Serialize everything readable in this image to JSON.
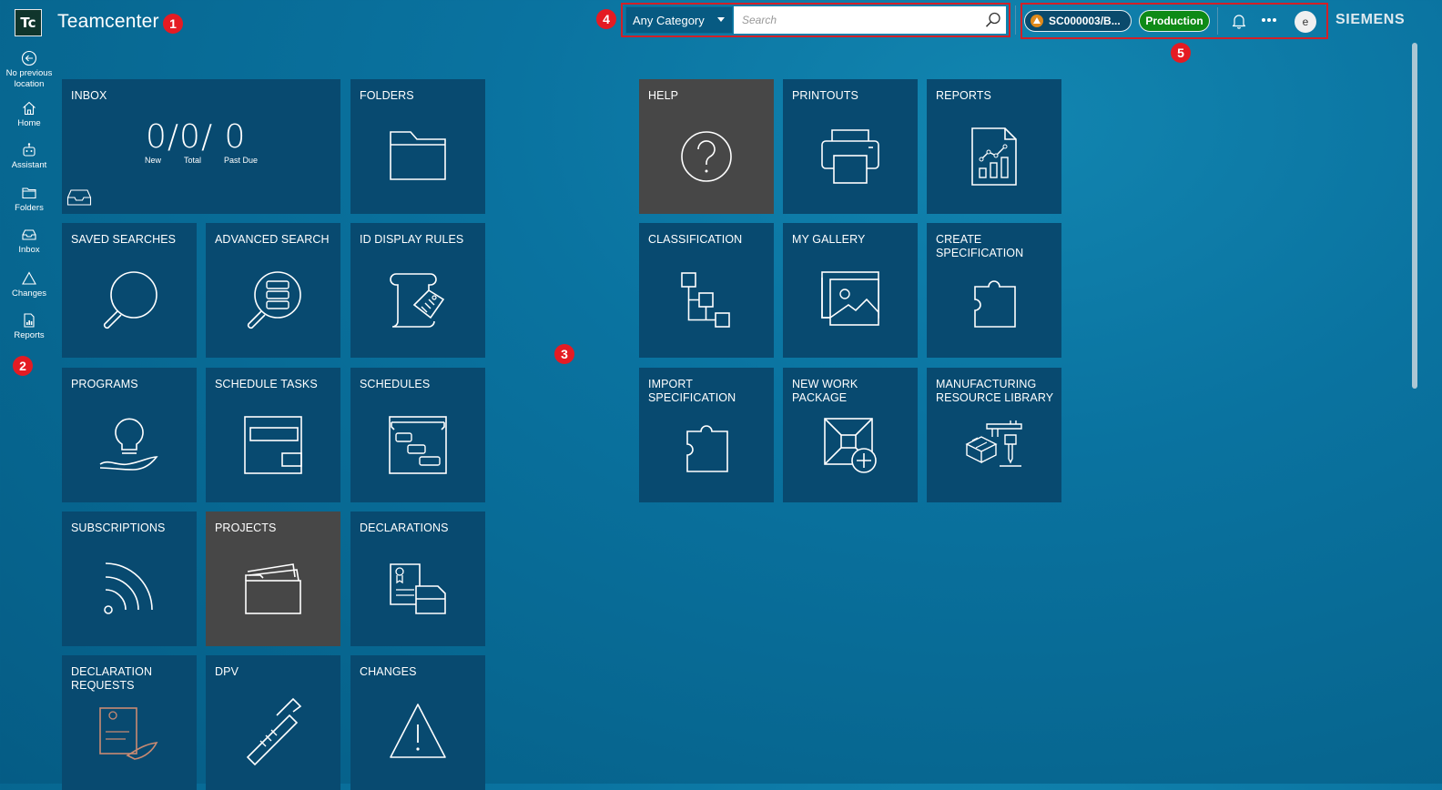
{
  "header": {
    "logo_text": "Tc",
    "app_title": "Teamcenter",
    "search": {
      "category": "Any Category",
      "placeholder": "Search"
    },
    "context_label": "SC000003/B...",
    "environment_label": "Production",
    "user_initial": "e",
    "brand": "SIEMENS"
  },
  "markers": [
    "1",
    "2",
    "3",
    "4",
    "5"
  ],
  "sidebar": {
    "items": [
      {
        "label_line1": "No previous",
        "label_line2": "location",
        "icon": "back-arrow-icon"
      },
      {
        "label_line1": "Home",
        "icon": "home-icon"
      },
      {
        "label_line1": "Assistant",
        "icon": "assistant-icon"
      },
      {
        "label_line1": "Folders",
        "icon": "folder-icon"
      },
      {
        "label_line1": "Inbox",
        "icon": "inbox-icon"
      },
      {
        "label_line1": "Changes",
        "icon": "warning-icon"
      },
      {
        "label_line1": "Reports",
        "icon": "report-icon"
      }
    ]
  },
  "inbox": {
    "new": "0",
    "total": "0",
    "past_due": "0",
    "new_label": "New",
    "total_label": "Total",
    "past_due_label": "Past Due"
  },
  "tiles": [
    {
      "label": "INBOX"
    },
    {
      "label": "FOLDERS"
    },
    {
      "label": "HELP"
    },
    {
      "label": "PRINTOUTS"
    },
    {
      "label": "REPORTS"
    },
    {
      "label": "SAVED SEARCHES"
    },
    {
      "label": "ADVANCED SEARCH"
    },
    {
      "label": "ID DISPLAY RULES"
    },
    {
      "label": "CLASSIFICATION"
    },
    {
      "label": "MY GALLERY"
    },
    {
      "label": "CREATE SPECIFICATION"
    },
    {
      "label": "PROGRAMS"
    },
    {
      "label": "SCHEDULE TASKS"
    },
    {
      "label": "SCHEDULES"
    },
    {
      "label": "IMPORT SPECIFICATION"
    },
    {
      "label": "NEW WORK PACKAGE"
    },
    {
      "label": "MANUFACTURING RESOURCE LIBRARY"
    },
    {
      "label": "SUBSCRIPTIONS"
    },
    {
      "label": "PROJECTS"
    },
    {
      "label": "DECLARATIONS"
    },
    {
      "label": "DECLARATION REQUESTS"
    },
    {
      "label": "DPV"
    },
    {
      "label": "CHANGES"
    }
  ]
}
